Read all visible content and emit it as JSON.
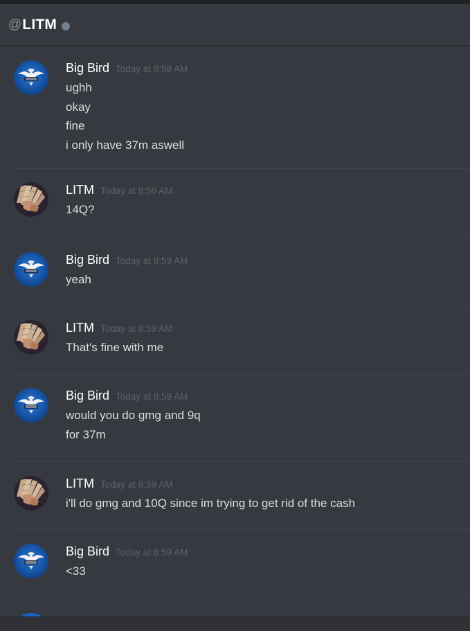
{
  "header": {
    "at": "@",
    "name": "LITM"
  },
  "colors": {
    "background": "#36393f",
    "username": "#ffffff",
    "timestamp": "#5e6268",
    "text": "#dcddde",
    "status_offline": "#747f8d"
  },
  "messages": [
    {
      "author": "Big Bird",
      "avatar_icon": "eagle-logo-icon",
      "time": "Today at 8:58 AM",
      "lines": [
        "ughh",
        "okay",
        "fine",
        "i only have 37m aswell"
      ]
    },
    {
      "author": "LITM",
      "avatar_icon": "cash-fan-icon",
      "time": "Today at 8:58 AM",
      "lines": [
        "14Q?"
      ]
    },
    {
      "author": "Big Bird",
      "avatar_icon": "eagle-logo-icon",
      "time": "Today at 8:59 AM",
      "lines": [
        "yeah"
      ]
    },
    {
      "author": "LITM",
      "avatar_icon": "cash-fan-icon",
      "time": "Today at 8:59 AM",
      "lines": [
        "That's fine with me"
      ]
    },
    {
      "author": "Big Bird",
      "avatar_icon": "eagle-logo-icon",
      "time": "Today at 8:59 AM",
      "lines": [
        "would you do gmg and 9q",
        "for 37m"
      ]
    },
    {
      "author": "LITM",
      "avatar_icon": "cash-fan-icon",
      "time": "Today at 8:59 AM",
      "lines": [
        "i'll do gmg and 10Q since im trying to get rid of the cash"
      ]
    },
    {
      "author": "Big Bird",
      "avatar_icon": "eagle-logo-icon",
      "time": "Today at 8:59 AM",
      "lines": [
        "<33"
      ]
    }
  ]
}
